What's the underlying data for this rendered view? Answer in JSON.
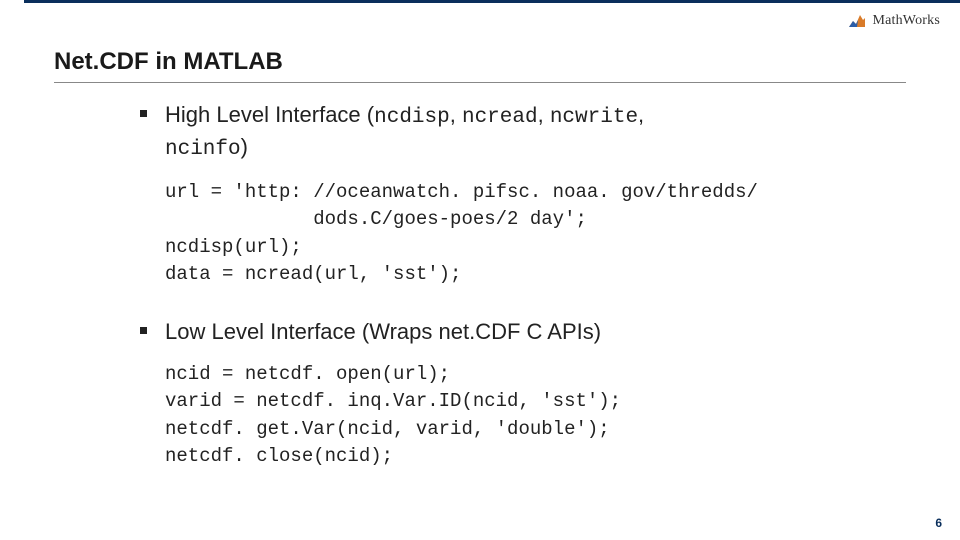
{
  "brand": {
    "name": "MathWorks"
  },
  "title": "Net.CDF in MATLAB",
  "bullets": {
    "b1_prefix": "High Level Interface (",
    "b1_codes": {
      "c1": "ncdisp",
      "c2": "ncread",
      "c3": "ncwrite",
      "c4": "ncinfo"
    },
    "b1_suffix": ")",
    "b2": "Low Level Interface (Wraps net.CDF C APIs)"
  },
  "code1": "url = 'http: //oceanwatch. pifsc. noaa. gov/thredds/\n             dods.C/goes-poes/2 day';\nncdisp(url);\ndata = ncread(url, 'sst');",
  "code2": "ncid = netcdf. open(url);\nvarid = netcdf. inq.Var.ID(ncid, 'sst');\nnetcdf. get.Var(ncid, varid, 'double');\nnetcdf. close(ncid);",
  "page_number": "6"
}
